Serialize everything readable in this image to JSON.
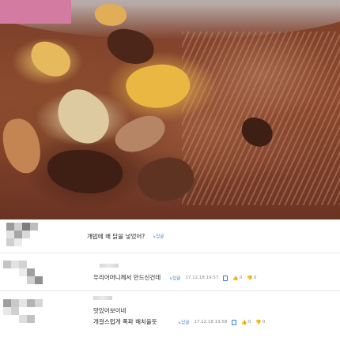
{
  "photo": {
    "alt_icon": "food-photo"
  },
  "comments": [
    {
      "text": "개밥에 왜 닭을 넣었어?",
      "reply_label": "답글"
    },
    {
      "text": "우리어머니께서 만드신건데",
      "reply_label": "답글",
      "timestamp": "17.12.18 19:57",
      "likes": "0",
      "dislikes": "0"
    },
    {
      "text_line1": "맛있어보이네",
      "text_line2": "개걸스럽게 폭파 해치울듯",
      "reply_label": "답글",
      "timestamp": "17.12.18 19:58",
      "likes": "0",
      "dislikes": "0"
    }
  ],
  "colors": {
    "reply": "#3a7bd5",
    "dislike": "#d33333",
    "divider": "#e6e6e6"
  }
}
